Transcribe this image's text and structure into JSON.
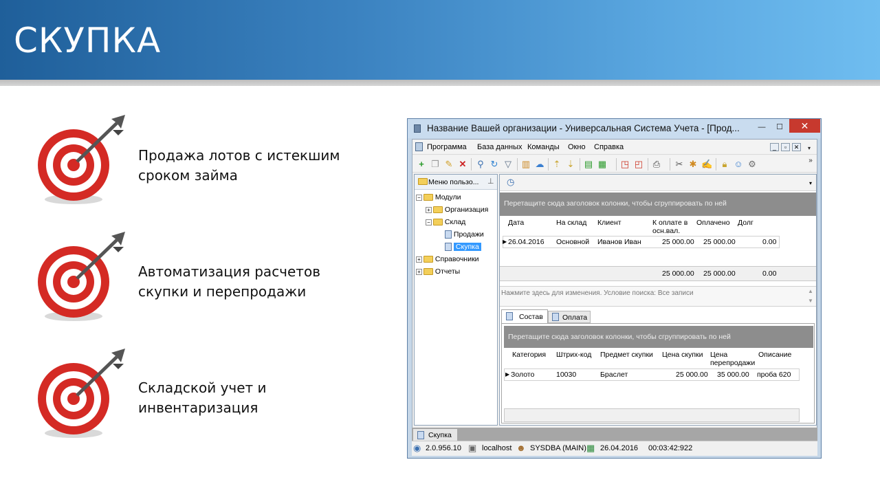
{
  "slide": {
    "title": "СКУПКА",
    "bullets": [
      {
        "text": "Продажа лотов с истекшим сроком займа"
      },
      {
        "text": "Автоматизация расчетов скупки и перепродажи"
      },
      {
        "text": "Складской учет и инвентаризация"
      }
    ],
    "accent_color": "#d42a24"
  },
  "window": {
    "title": "Название Вашей организации - Универсальная Система Учета - [Прод...",
    "menu": [
      "Программа",
      "База данных",
      "Команды",
      "Окно",
      "Справка"
    ],
    "left_panel": {
      "header": "Меню пользо...",
      "tree": [
        {
          "label": "Модули"
        },
        {
          "label": "Организация"
        },
        {
          "label": "Склад"
        },
        {
          "label": "Продажи"
        },
        {
          "label": "Скупка"
        },
        {
          "label": "Справочники"
        },
        {
          "label": "Отчеты"
        }
      ]
    },
    "main_grid": {
      "group_hint": "Перетащите сюда заголовок колонки, чтобы сгруппировать по ней",
      "columns": [
        "Дата",
        "На склад",
        "Клиент",
        "К оплате в осн.вал.",
        "Оплачено",
        "Долг"
      ],
      "row": [
        "26.04.2016",
        "Основной",
        "Иванов Иван",
        "25 000.00",
        "25 000.00",
        "0.00"
      ],
      "totals": [
        "25 000.00",
        "25 000.00",
        "0.00"
      ],
      "filter_text": "Нажмите здесь для изменения. Условие поиска: Все записи"
    },
    "detail": {
      "tabs": [
        "Состав",
        "Оплата"
      ],
      "group_hint": "Перетащите сюда заголовок колонки, чтобы сгруппировать по ней",
      "columns": [
        "Категория",
        "Штрих-код",
        "Предмет скупки",
        "Цена скупки",
        "Цена перепродажи",
        "Описание"
      ],
      "row": [
        "Золото",
        "10030",
        "Браслет",
        "25 000.00",
        "35 000.00",
        "проба 620"
      ]
    },
    "bottom_tab": "Скупка",
    "status": {
      "version": "2.0.956.10",
      "host": "localhost",
      "user": "SYSDBA (MAIN)",
      "date": "26.04.2016",
      "timer": "00:03:42:922"
    }
  }
}
